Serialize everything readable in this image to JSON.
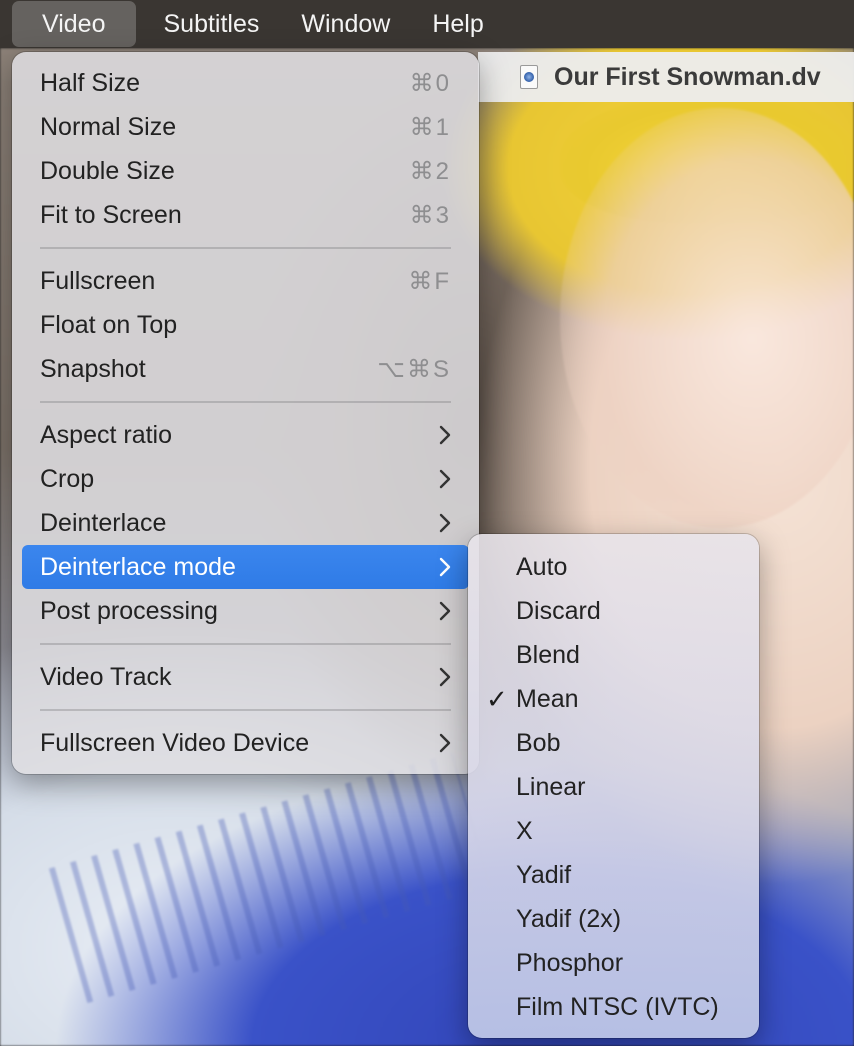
{
  "menubar": {
    "items": [
      "Video",
      "Subtitles",
      "Window",
      "Help"
    ]
  },
  "window": {
    "title": "Our First Snowman.dv",
    "icon": "dv-document-icon"
  },
  "video_menu": {
    "items": [
      {
        "label": "Half Size",
        "shortcut": "⌘0"
      },
      {
        "label": "Normal Size",
        "shortcut": "⌘1"
      },
      {
        "label": "Double Size",
        "shortcut": "⌘2"
      },
      {
        "label": "Fit to Screen",
        "shortcut": "⌘3"
      },
      {
        "label": "Fullscreen",
        "shortcut": "⌘F"
      },
      {
        "label": "Float on Top"
      },
      {
        "label": "Snapshot",
        "shortcut": "⌥⌘S"
      },
      {
        "label": "Aspect ratio",
        "submenu": true
      },
      {
        "label": "Crop",
        "submenu": true
      },
      {
        "label": "Deinterlace",
        "submenu": true
      },
      {
        "label": "Deinterlace mode",
        "submenu": true,
        "highlighted": true
      },
      {
        "label": "Post processing",
        "submenu": true
      },
      {
        "label": "Video Track",
        "submenu": true
      },
      {
        "label": "Fullscreen Video Device",
        "submenu": true
      }
    ]
  },
  "deinterlace_mode_menu": {
    "checkmark": "✓",
    "selected": "Mean",
    "items": [
      "Auto",
      "Discard",
      "Blend",
      "Mean",
      "Bob",
      "Linear",
      "X",
      "Yadif",
      "Yadif (2x)",
      "Phosphor",
      "Film NTSC (IVTC)"
    ]
  },
  "colors": {
    "highlight": "#2f7be6",
    "menubar": "#3a3632",
    "shortcut_text": "#8e8e90"
  }
}
